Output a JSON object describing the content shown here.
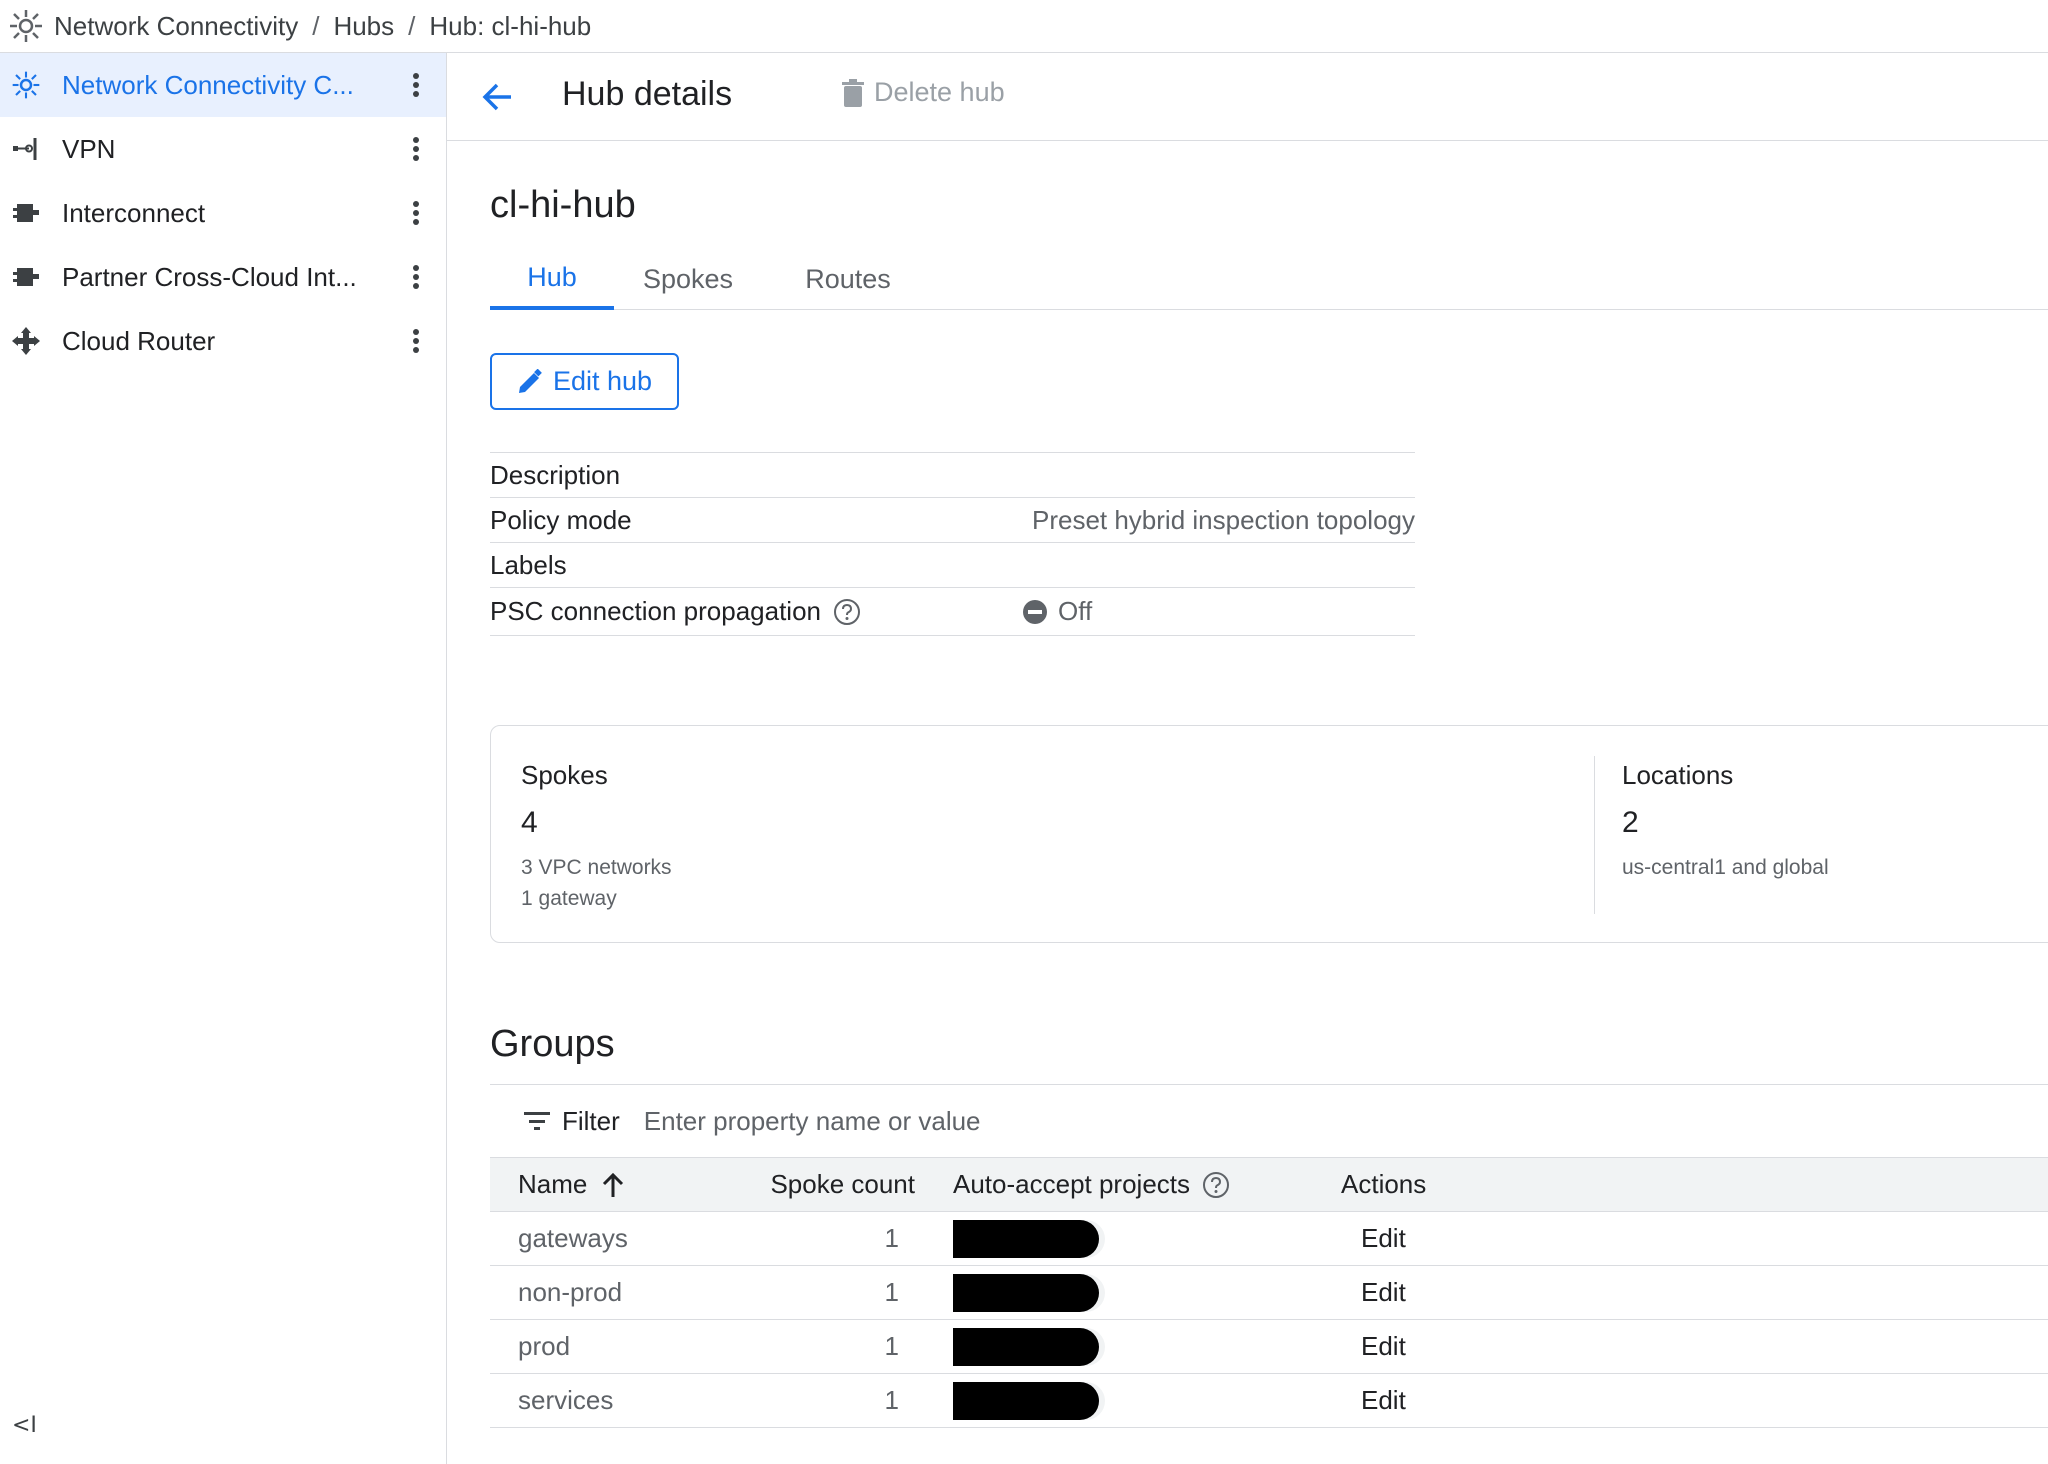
{
  "breadcrumb": {
    "items": [
      "Network Connectivity",
      "Hubs",
      "Hub: cl-hi-hub"
    ],
    "separator": "/"
  },
  "sidebar": {
    "items": [
      {
        "label": "Network Connectivity C...",
        "icon": "network-hub-icon",
        "active": true
      },
      {
        "label": "VPN",
        "icon": "vpn-icon",
        "active": false
      },
      {
        "label": "Interconnect",
        "icon": "interconnect-icon",
        "active": false
      },
      {
        "label": "Partner Cross-Cloud Int...",
        "icon": "interconnect-icon",
        "active": false
      },
      {
        "label": "Cloud Router",
        "icon": "cloud-router-icon",
        "active": false
      }
    ],
    "collapse_label": "<I"
  },
  "header": {
    "title": "Hub details",
    "delete_label": "Delete hub"
  },
  "hub": {
    "name": "cl-hi-hub",
    "tabs": [
      {
        "label": "Hub",
        "active": true
      },
      {
        "label": "Spokes",
        "active": false
      },
      {
        "label": "Routes",
        "active": false
      }
    ],
    "edit_label": "Edit hub",
    "properties": {
      "description_label": "Description",
      "description_value": "",
      "policy_mode_label": "Policy mode",
      "policy_mode_value": "Preset hybrid inspection topology",
      "labels_label": "Labels",
      "labels_value": "",
      "psc_label": "PSC connection propagation",
      "psc_value": "Off"
    }
  },
  "summary": {
    "spokes": {
      "title": "Spokes",
      "count": "4",
      "detail_1": "3 VPC networks",
      "detail_2": "1 gateway"
    },
    "locations": {
      "title": "Locations",
      "count": "2",
      "detail_1": "us-central1 and global"
    }
  },
  "groups": {
    "title": "Groups",
    "filter_label": "Filter",
    "filter_placeholder": "Enter property name or value",
    "columns": {
      "name": "Name",
      "spoke_count": "Spoke count",
      "auto_accept": "Auto-accept projects",
      "actions": "Actions"
    },
    "rows": [
      {
        "name": "gateways",
        "spoke_count": "1",
        "action": "Edit"
      },
      {
        "name": "non-prod",
        "spoke_count": "1",
        "action": "Edit"
      },
      {
        "name": "prod",
        "spoke_count": "1",
        "action": "Edit"
      },
      {
        "name": "services",
        "spoke_count": "1",
        "action": "Edit"
      }
    ]
  },
  "colors": {
    "accent": "#1a73e8",
    "active_nav_bg": "#e8f0fe",
    "border": "#dadce0",
    "muted_text": "#5f6368"
  }
}
